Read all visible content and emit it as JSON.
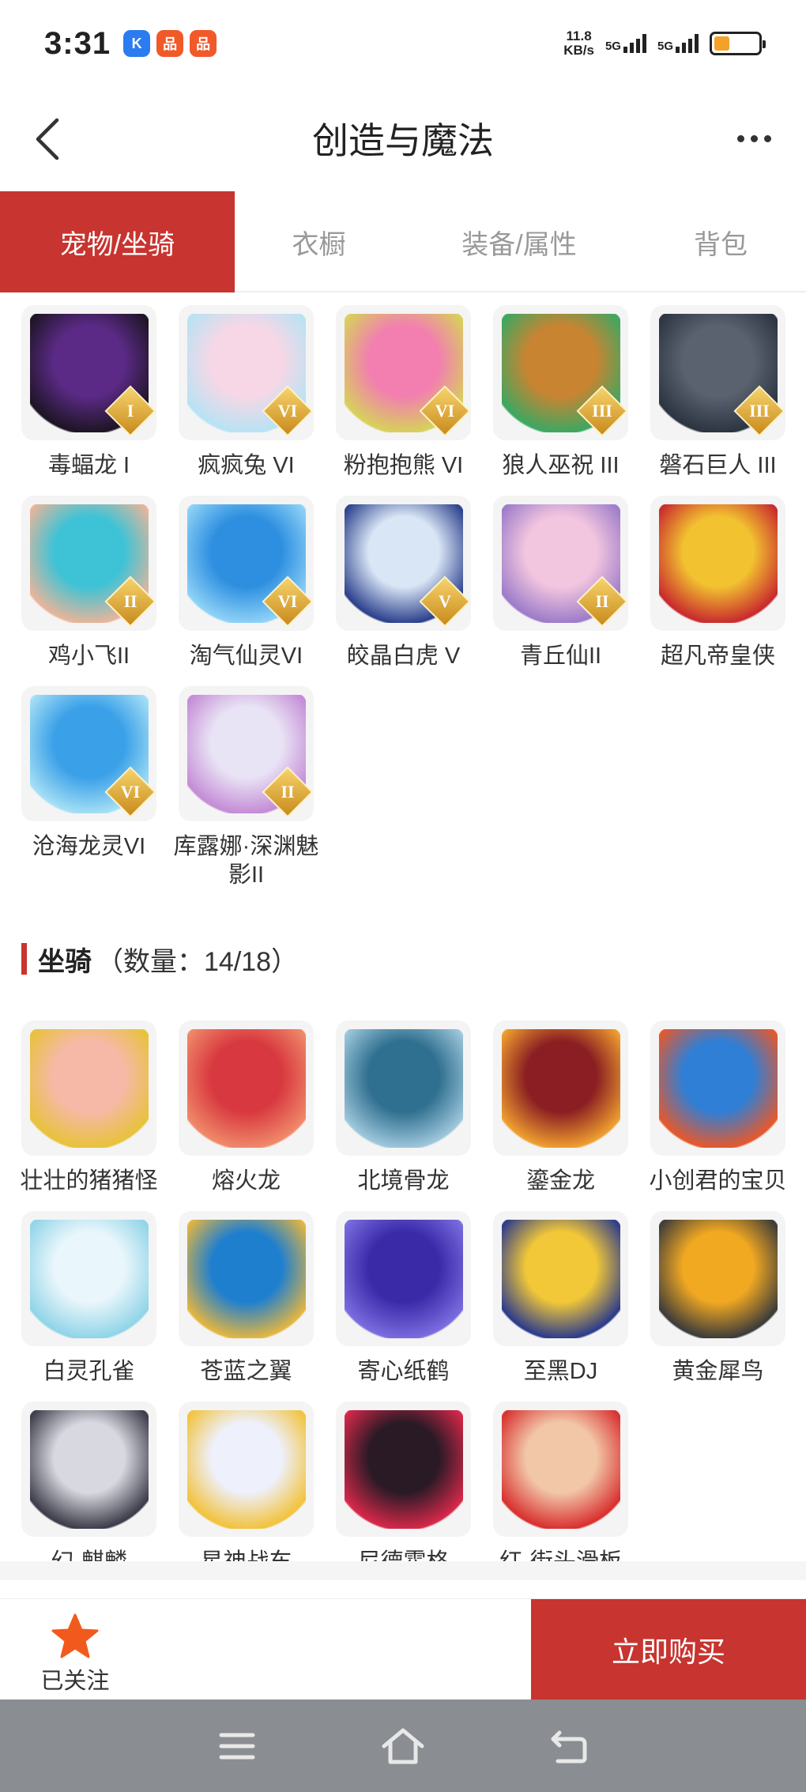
{
  "status_bar": {
    "time": "3:31",
    "apps": [
      {
        "icon": "k-app-icon",
        "glyph": "K",
        "color": "#2b7cf0"
      },
      {
        "icon": "shop-app-icon",
        "glyph": "品",
        "color": "#f05a28"
      },
      {
        "icon": "deal-app-icon",
        "glyph": "品",
        "color": "#f2592a"
      }
    ],
    "speed_value": "11.8",
    "speed_unit": "KB/s",
    "net1": "5G",
    "net2": "5G",
    "battery_level": 0.35
  },
  "header": {
    "title": "创造与魔法"
  },
  "tabs": [
    {
      "label": "宠物/坐骑",
      "active": true
    },
    {
      "label": "衣橱",
      "active": false
    },
    {
      "label": "装备/属性",
      "active": false
    },
    {
      "label": "背包",
      "active": false
    }
  ],
  "pets": [
    {
      "name": "毒蝠龙 I",
      "rank": "I",
      "colors": [
        "#5b2a86",
        "#1c1422"
      ]
    },
    {
      "name": "疯疯兔 VI",
      "rank": "VI",
      "colors": [
        "#f7d7e6",
        "#b6e3f4"
      ]
    },
    {
      "name": "粉抱抱熊 VI",
      "rank": "VI",
      "colors": [
        "#f27fb0",
        "#d7d25a"
      ]
    },
    {
      "name": "狼人巫祝 III",
      "rank": "III",
      "colors": [
        "#c98432",
        "#3aa862"
      ]
    },
    {
      "name": "磐石巨人 III",
      "rank": "III",
      "colors": [
        "#5a6270",
        "#2b3440"
      ]
    },
    {
      "name": "鸡小飞II",
      "rank": "II",
      "colors": [
        "#3ec3d6",
        "#e9b59a"
      ]
    },
    {
      "name": "淘气仙灵VI",
      "rank": "VI",
      "colors": [
        "#2e8fe0",
        "#8fd3f7"
      ]
    },
    {
      "name": "皎晶白虎 V",
      "rank": "V",
      "colors": [
        "#d9e6f5",
        "#2a3f8c"
      ]
    },
    {
      "name": "青丘仙II",
      "rank": "II",
      "colors": [
        "#f3c6df",
        "#9b7bc9"
      ]
    },
    {
      "name": "超凡帝皇侠",
      "rank": "",
      "colors": [
        "#f2c230",
        "#c8282d"
      ]
    },
    {
      "name": "沧海龙灵VI",
      "rank": "VI",
      "colors": [
        "#3aa0e8",
        "#a6e0f5"
      ]
    },
    {
      "name": "库露娜·深渊魅影II",
      "rank": "II",
      "colors": [
        "#e9e4f5",
        "#c48ad6"
      ]
    }
  ],
  "mount_section": {
    "label": "坐骑",
    "count": "（数量：14/18）"
  },
  "mounts": [
    {
      "name": "壮壮的猪猪怪",
      "colors": [
        "#f6b9a8",
        "#e8c23a"
      ]
    },
    {
      "name": "熔火龙",
      "colors": [
        "#d8383f",
        "#f08a6a"
      ]
    },
    {
      "name": "北境骨龙",
      "colors": [
        "#2f6f8f",
        "#9fc8dc"
      ]
    },
    {
      "name": "鎏金龙",
      "colors": [
        "#8a1e22",
        "#f0a030"
      ]
    },
    {
      "name": "小创君的宝贝",
      "colors": [
        "#2f7fd6",
        "#e8582a"
      ]
    },
    {
      "name": "白灵孔雀",
      "colors": [
        "#e9f6fb",
        "#8fd4e8"
      ]
    },
    {
      "name": "苍蓝之翼",
      "colors": [
        "#1f7fcf",
        "#e6b640"
      ]
    },
    {
      "name": "寄心纸鹤",
      "colors": [
        "#3b2aa8",
        "#7b6de0"
      ]
    },
    {
      "name": "至黑DJ",
      "colors": [
        "#f2c838",
        "#2a3a8c"
      ]
    },
    {
      "name": "黄金犀鸟",
      "colors": [
        "#f2a922",
        "#3a3a3a"
      ]
    },
    {
      "name": "幻·麒麟",
      "colors": [
        "#d8d8e0",
        "#3a3a48"
      ]
    },
    {
      "name": "星神战车",
      "colors": [
        "#eef0fb",
        "#f2c23a"
      ]
    },
    {
      "name": "尼德霍格",
      "colors": [
        "#2a1a26",
        "#d8284a"
      ]
    },
    {
      "name": "红-街头滑板",
      "colors": [
        "#f2c7a8",
        "#d82e2e"
      ]
    }
  ],
  "bottom_bar": {
    "follow_label": "已关注",
    "buy_label": "立即购买"
  }
}
